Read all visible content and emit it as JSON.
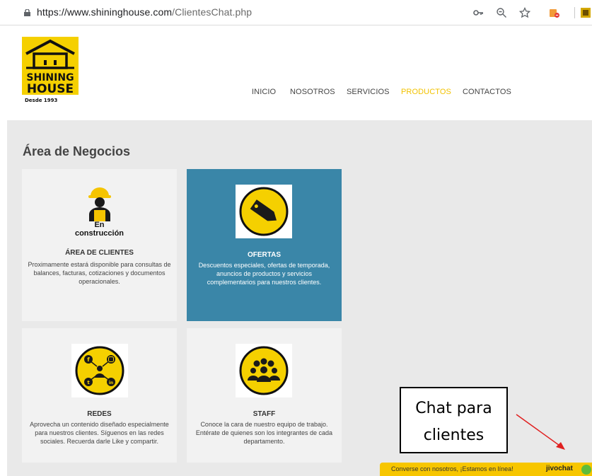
{
  "browser": {
    "url_host": "https://www.shininghouse.com",
    "url_path": "/ClientesChat.php"
  },
  "logo": {
    "line1": "SHINING",
    "line2": "HOUSE",
    "since": "Desde 1993"
  },
  "nav": {
    "items": [
      {
        "label": "INICIO",
        "active": false
      },
      {
        "label": "NOSOTROS",
        "active": false
      },
      {
        "label": "SERVICIOS",
        "active": false
      },
      {
        "label": "PRODUCTOS",
        "active": true
      },
      {
        "label": "CONTACTOS",
        "active": false
      }
    ]
  },
  "page": {
    "title": "Área de Negocios"
  },
  "cards": [
    {
      "badge_line1": "En",
      "badge_line2": "construcción",
      "title": "ÁREA DE CLIENTES",
      "text": "Proximamente estará disponible para consultas de balances, facturas, cotizaciones y documentos operacionales."
    },
    {
      "title": "OFERTAS",
      "text": "Descuentos especiales, ofertas de temporada, anuncios de productos y servicios complementarios para nuestros clientes."
    },
    {
      "title": "REDES",
      "text": "Aprovecha un contenido diseñado especialmente para nuestros clientes. Síguenos en las redes sociales. Recuerda darle Like y compartir."
    },
    {
      "title": "STAFF",
      "text": "Conoce la cara de nuestro equipo de trabajo. Entérate de quienes son los integrantes de cada departamento."
    }
  ],
  "annotation": {
    "line1": "Chat para",
    "line2": "clientes"
  },
  "chat": {
    "message": "Converse con nosotros, ¡Estamos en línea!",
    "brand": "jivochat"
  },
  "colors": {
    "accent_yellow": "#f2c200",
    "card_blue": "#3a86a8",
    "chat_yellow": "#f7c600"
  }
}
